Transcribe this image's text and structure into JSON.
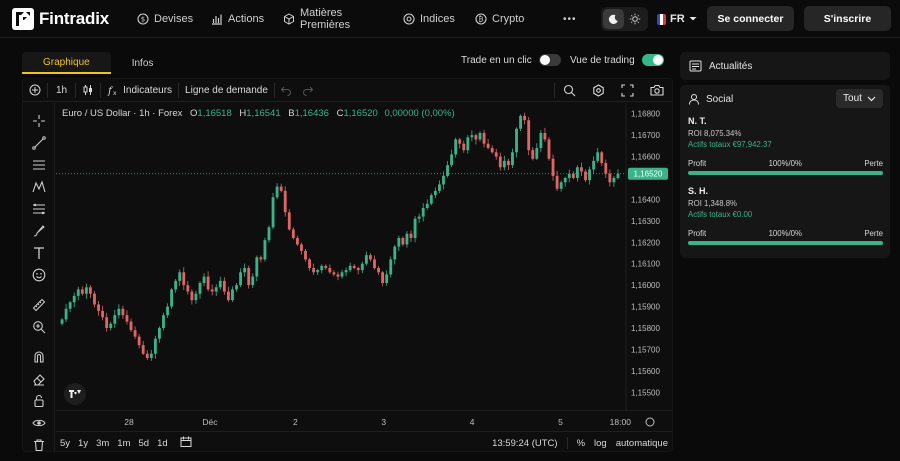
{
  "nav": {
    "logo": "Fintradix",
    "items": [
      {
        "label": "Devises",
        "icon": "coin-icon"
      },
      {
        "label": "Actions",
        "icon": "bar-chart-icon"
      },
      {
        "label": "Matières",
        "label2": "Premières",
        "icon": "box-icon"
      },
      {
        "label": "Indices",
        "icon": "indices-icon"
      },
      {
        "label": "Crypto",
        "icon": "bitcoin-icon"
      }
    ],
    "more": "•••",
    "language": "FR",
    "login": "Se connecter",
    "signup": "S'inscrire"
  },
  "tabs": [
    {
      "label": "Graphique",
      "active": true
    },
    {
      "label": "Infos",
      "active": false
    }
  ],
  "toggles": {
    "one_click": {
      "label": "Trade en un clic",
      "on": false
    },
    "trading_view": {
      "label": "Vue de trading",
      "on": true
    }
  },
  "toolbar": {
    "interval": "1h",
    "indicators": "Indicateurs",
    "demand_line": "Ligne de demande"
  },
  "legend": {
    "symbol": "Euro / US Dollar · 1h · Forex",
    "open_label": "O",
    "open": "1,16518",
    "high_label": "H",
    "high": "1,16541",
    "low_label": "B",
    "low": "1,16436",
    "close_label": "C",
    "close": "1,16520",
    "change": "0,00000 (0,00%)"
  },
  "chart_data": {
    "type": "candlestick",
    "symbol": "Euro / US Dollar",
    "interval": "1h",
    "market": "Forex",
    "ylim": [
      1.1545,
      1.1685
    ],
    "y_ticks": [
      "1,16800",
      "1,16700",
      "1,16600",
      "1,16520",
      "1,16400",
      "1,16300",
      "1,16200",
      "1,16100",
      "1,16000",
      "1,15900",
      "1,15800",
      "1,15700",
      "1,15600",
      "1,15500"
    ],
    "x_ticks": [
      "28",
      "Déc",
      "2",
      "3",
      "4",
      "5",
      "18:00"
    ],
    "last_price": "1,16520",
    "up_color": "#3bb38a",
    "down_color": "#e06565",
    "close_series": [
      1.1584,
      1.1589,
      1.1592,
      1.1595,
      1.1598,
      1.1596,
      1.1599,
      1.1596,
      1.1591,
      1.1588,
      1.1585,
      1.158,
      1.1582,
      1.1586,
      1.1589,
      1.1586,
      1.1583,
      1.1579,
      1.1576,
      1.1572,
      1.1568,
      1.1566,
      1.1568,
      1.1575,
      1.158,
      1.1586,
      1.159,
      1.1598,
      1.1602,
      1.1606,
      1.16,
      1.1597,
      1.1593,
      1.1596,
      1.1601,
      1.1604,
      1.1598,
      1.1597,
      1.1599,
      1.1602,
      1.1597,
      1.1593,
      1.1598,
      1.16,
      1.1606,
      1.1608,
      1.16,
      1.1604,
      1.1613,
      1.1612,
      1.1621,
      1.1627,
      1.1641,
      1.1646,
      1.1644,
      1.1634,
      1.1626,
      1.1622,
      1.1619,
      1.1616,
      1.1612,
      1.1608,
      1.1606,
      1.1607,
      1.1609,
      1.1608,
      1.1606,
      1.1605,
      1.1604,
      1.1606,
      1.1607,
      1.1609,
      1.1608,
      1.1607,
      1.161,
      1.1614,
      1.1612,
      1.1608,
      1.1606,
      1.1601,
      1.1605,
      1.1612,
      1.1618,
      1.1622,
      1.1619,
      1.1624,
      1.1622,
      1.1631,
      1.1632,
      1.1636,
      1.1638,
      1.1642,
      1.1644,
      1.1647,
      1.1651,
      1.1656,
      1.1661,
      1.1668,
      1.1666,
      1.1663,
      1.1669,
      1.167,
      1.1668,
      1.1671,
      1.1666,
      1.1664,
      1.1662,
      1.166,
      1.1655,
      1.1658,
      1.1656,
      1.1662,
      1.1673,
      1.1679,
      1.1677,
      1.1663,
      1.1659,
      1.1664,
      1.1671,
      1.1668,
      1.1659,
      1.1651,
      1.1645,
      1.1648,
      1.165,
      1.1652,
      1.165,
      1.1655,
      1.1653,
      1.1649,
      1.1654,
      1.1658,
      1.1662,
      1.1657,
      1.1652,
      1.1648,
      1.165,
      1.1652
    ]
  },
  "bottom": {
    "ranges": [
      "5y",
      "1y",
      "3m",
      "1m",
      "5d",
      "1d"
    ],
    "time": "13:59:24 (UTC)",
    "percent": "%",
    "log": "log",
    "auto": "automatique"
  },
  "news": {
    "title": "Actualités"
  },
  "social": {
    "title": "Social",
    "filter": "Tout",
    "traders": [
      {
        "name": "N. T.",
        "roi": "ROI 8,075.34%",
        "assets": "Actifs totaux €97,942.37",
        "profit_label": "Profit",
        "ratio": "100%/0%",
        "loss_label": "Perte",
        "profit_share": 1.0
      },
      {
        "name": "S. H.",
        "roi": "ROI 1,348.8%",
        "assets": "Actifs totaux €0.00",
        "profit_label": "Profit",
        "ratio": "100%/0%",
        "loss_label": "Perte",
        "profit_share": 1.0
      }
    ]
  }
}
